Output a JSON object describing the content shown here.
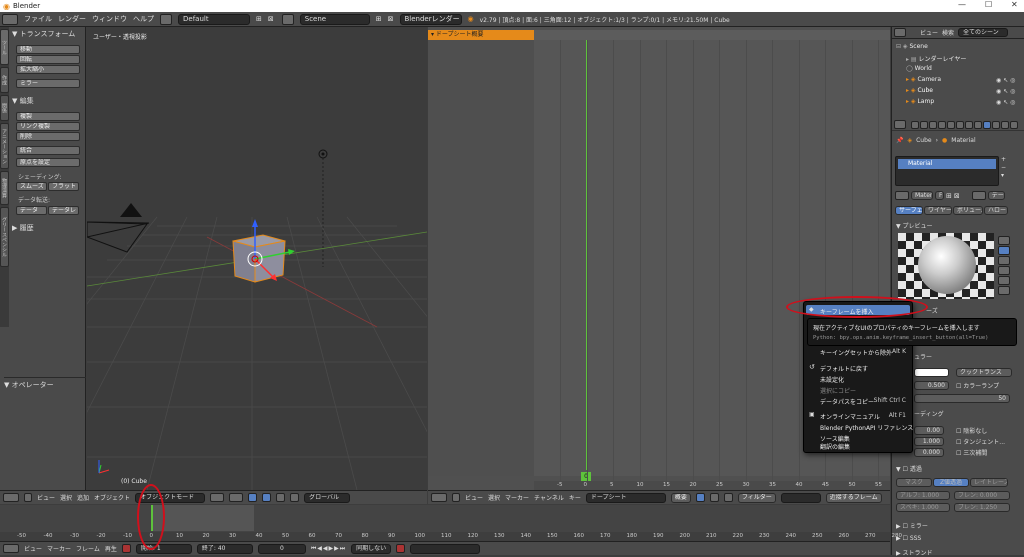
{
  "window": {
    "title": "Blender",
    "minimize": "—",
    "maximize": "☐",
    "close": "✕"
  },
  "menubar": {
    "items": [
      "ファイル",
      "レンダー",
      "ウィンドウ",
      "ヘルプ"
    ],
    "layout": "Default",
    "scene": "Scene",
    "engine": "Blenderレンダー",
    "stats": "v2.79 | 頂点:8 | 面:6 | 三角面:12 | オブジェクト:1/3 | ランプ:0/1 | メモリ:21.50M | Cube"
  },
  "toolshelf": {
    "tabs": [
      "ツール",
      "作成",
      "関係",
      "アニメーション",
      "物理演算",
      "グリースペンシル"
    ],
    "transform_header": "▼ トランスフォーム",
    "transform": [
      "移動",
      "回転",
      "拡大縮小"
    ],
    "mirror": "ミラー",
    "edit_header": "▼ 編集",
    "edit": [
      "複製",
      "リンク複製",
      "削除"
    ],
    "join": "統合",
    "origin": "原点を設定",
    "shading_label": "シェーディング:",
    "smooth": "スムーズ",
    "flat": "フラット",
    "datatransfer_label": "データ転送:",
    "data": "データ",
    "data_layer": "データレ",
    "history": "▶ 履歴",
    "operator": "▼ オペレーター"
  },
  "viewport": {
    "label": "ユーザー・透視投影",
    "object_label": "(0) Cube",
    "header": {
      "menus": [
        "ビュー",
        "選択",
        "追加",
        "オブジェクト"
      ],
      "mode": "オブジェクトモード",
      "orientation": "グローバル"
    }
  },
  "dopesheet": {
    "channel": "ドープシート概要",
    "current_frame": "0",
    "ticks": [
      "-5",
      "0",
      "5",
      "10",
      "15",
      "20",
      "25",
      "30",
      "35",
      "40",
      "45",
      "50",
      "55"
    ],
    "header": {
      "menus": [
        "ビュー",
        "選択",
        "マーカー",
        "チャンネル",
        "キー"
      ],
      "mode": "ドープシート",
      "summary": "概要",
      "filter": "フィルター",
      "nearest": "近接するフレーム"
    }
  },
  "outliner": {
    "view": "ビュー",
    "search": "検索",
    "scope": "全てのシーン",
    "items": [
      "Scene",
      "レンダーレイヤー",
      "World",
      "Camera",
      "Cube",
      "Lamp"
    ]
  },
  "properties": {
    "breadcrumb": [
      "Cube",
      "Material"
    ],
    "material_slot": "Material",
    "material_name": "Materi",
    "material_user": "F",
    "data_btn": "デー",
    "tabs": [
      "サーフェ",
      "ワイヤー",
      "ボリューム",
      "ハロー"
    ],
    "preview_header": "▼ プレビュー",
    "diffuse_suffix": "ーズ",
    "specular_suffix": "ュラー",
    "shader": "クックトランス",
    "intensity": "0.500",
    "ramp": "カラーランプ",
    "hardness": "50",
    "shading_suffix": "ーディング",
    "emit": "0.00",
    "shadeless": "陰影なし",
    "ambient": "1.000",
    "tangent": "タンジェント...",
    "translucency": "0.000",
    "cubic": "三次補間",
    "transparency": "透過",
    "mask": "マスク",
    "zt": "Z値透過",
    "raytrace": "レイトレース",
    "alpha": "アルフ: 1.000",
    "spec": "スペキ: 1.000",
    "fresnel": "フレン: 0.000",
    "blend": "ブレン: 1.250",
    "mirror": "ミラー",
    "sss": "SSS",
    "strand": "ストランド"
  },
  "context_menu": {
    "items": [
      {
        "label": "キーフレームを挿入",
        "shortcut": ""
      },
      {
        "label": "ドラ",
        "shortcut": ""
      },
      {
        "label": "キー",
        "shortcut": ""
      },
      {
        "label": "キーイングセットから除外",
        "shortcut": "Alt K"
      },
      {
        "label": "デフォルトに戻す",
        "shortcut": ""
      },
      {
        "label": "未設定化",
        "shortcut": ""
      },
      {
        "label": "選択にコピー",
        "shortcut": ""
      },
      {
        "label": "データパスをコピー",
        "shortcut": "Shift Ctrl C"
      },
      {
        "label": "オンラインマニュアル",
        "shortcut": "Alt F1"
      },
      {
        "label": "Blender PythonAPI リファレンス",
        "shortcut": ""
      },
      {
        "label": "ソース編集",
        "shortcut": ""
      },
      {
        "label": "翻訳の編集",
        "shortcut": ""
      }
    ],
    "tooltip_title": "現在アクティブなUIのプロパティのキーフレームを挿入します",
    "tooltip_python": "Python: bpy.ops.anim.keyframe_insert_button(all=True)"
  },
  "timeline": {
    "ticks": [
      "-50",
      "-40",
      "-30",
      "-20",
      "-10",
      "0",
      "10",
      "20",
      "30",
      "40",
      "50",
      "60",
      "70",
      "80",
      "90",
      "100",
      "110",
      "120",
      "130",
      "140",
      "150",
      "160",
      "170",
      "180",
      "190",
      "200",
      "210",
      "220",
      "230",
      "240",
      "250",
      "260",
      "270",
      "280"
    ],
    "header": {
      "menus": [
        "ビュー",
        "マーカー",
        "フレーム",
        "再生"
      ],
      "start": "開始:",
      "start_val": "1",
      "end": "終了:",
      "end_val": "40",
      "frame": "0",
      "sync": "同期しない"
    }
  },
  "colors": {
    "accent_orange": "#e58a1a",
    "highlight_blue": "#5680c2",
    "frame_green": "#5ec23c",
    "annotation_red": "#d0101c"
  }
}
